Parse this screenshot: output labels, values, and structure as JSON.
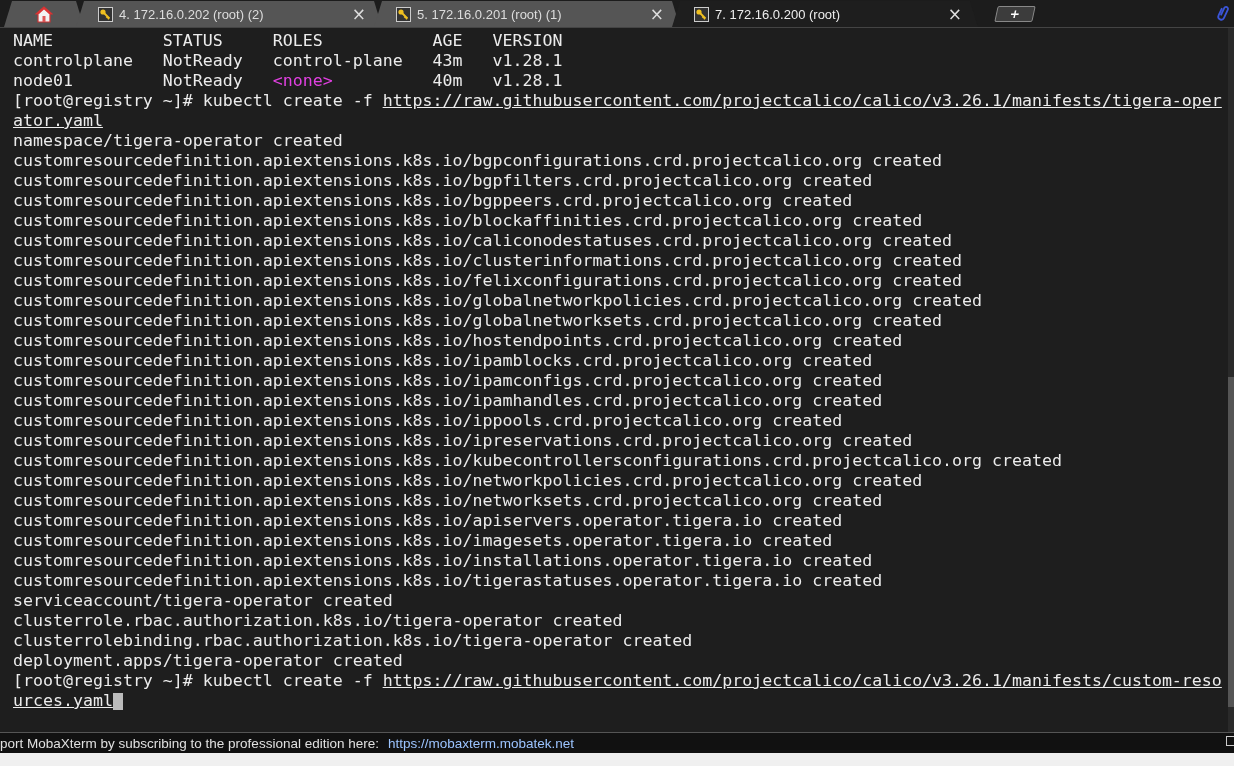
{
  "tabs": [
    {
      "kind": "home",
      "selected": false
    },
    {
      "kind": "session",
      "label": "4. 172.16.0.202 (root) (2)",
      "selected": false,
      "close": "×"
    },
    {
      "kind": "session",
      "label": "5. 172.16.0.201 (root) (1)",
      "selected": false,
      "close": "×"
    },
    {
      "kind": "session",
      "label": "7. 172.16.0.200 (root)",
      "selected": true,
      "close": "×"
    },
    {
      "kind": "new",
      "label": "+"
    }
  ],
  "terminal": {
    "lines": [
      [
        {
          "kind": "text",
          "text": "NAME           STATUS     ROLES           AGE   VERSION"
        }
      ],
      [
        {
          "kind": "text",
          "text": "controlplane   NotReady   control-plane   43m   v1.28.1"
        }
      ],
      [
        {
          "kind": "text",
          "text": "node01         NotReady   "
        },
        {
          "kind": "none",
          "text": "<none>"
        },
        {
          "kind": "text",
          "text": "          40m   v1.28.1"
        }
      ],
      [
        {
          "kind": "text",
          "text": "[root@registry ~]# kubectl create -f "
        },
        {
          "kind": "link",
          "text": "https://raw.githubusercontent.com/projectcalico/calico/v3.26.1/manifests/tigera-oper"
        }
      ],
      [
        {
          "kind": "link",
          "text": "ator.yaml"
        }
      ],
      [
        {
          "kind": "text",
          "text": "namespace/tigera-operator created"
        }
      ],
      [
        {
          "kind": "text",
          "text": "customresourcedefinition.apiextensions.k8s.io/bgpconfigurations.crd.projectcalico.org created"
        }
      ],
      [
        {
          "kind": "text",
          "text": "customresourcedefinition.apiextensions.k8s.io/bgpfilters.crd.projectcalico.org created"
        }
      ],
      [
        {
          "kind": "text",
          "text": "customresourcedefinition.apiextensions.k8s.io/bgppeers.crd.projectcalico.org created"
        }
      ],
      [
        {
          "kind": "text",
          "text": "customresourcedefinition.apiextensions.k8s.io/blockaffinities.crd.projectcalico.org created"
        }
      ],
      [
        {
          "kind": "text",
          "text": "customresourcedefinition.apiextensions.k8s.io/caliconodestatuses.crd.projectcalico.org created"
        }
      ],
      [
        {
          "kind": "text",
          "text": "customresourcedefinition.apiextensions.k8s.io/clusterinformations.crd.projectcalico.org created"
        }
      ],
      [
        {
          "kind": "text",
          "text": "customresourcedefinition.apiextensions.k8s.io/felixconfigurations.crd.projectcalico.org created"
        }
      ],
      [
        {
          "kind": "text",
          "text": "customresourcedefinition.apiextensions.k8s.io/globalnetworkpolicies.crd.projectcalico.org created"
        }
      ],
      [
        {
          "kind": "text",
          "text": "customresourcedefinition.apiextensions.k8s.io/globalnetworksets.crd.projectcalico.org created"
        }
      ],
      [
        {
          "kind": "text",
          "text": "customresourcedefinition.apiextensions.k8s.io/hostendpoints.crd.projectcalico.org created"
        }
      ],
      [
        {
          "kind": "text",
          "text": "customresourcedefinition.apiextensions.k8s.io/ipamblocks.crd.projectcalico.org created"
        }
      ],
      [
        {
          "kind": "text",
          "text": "customresourcedefinition.apiextensions.k8s.io/ipamconfigs.crd.projectcalico.org created"
        }
      ],
      [
        {
          "kind": "text",
          "text": "customresourcedefinition.apiextensions.k8s.io/ipamhandles.crd.projectcalico.org created"
        }
      ],
      [
        {
          "kind": "text",
          "text": "customresourcedefinition.apiextensions.k8s.io/ippools.crd.projectcalico.org created"
        }
      ],
      [
        {
          "kind": "text",
          "text": "customresourcedefinition.apiextensions.k8s.io/ipreservations.crd.projectcalico.org created"
        }
      ],
      [
        {
          "kind": "text",
          "text": "customresourcedefinition.apiextensions.k8s.io/kubecontrollersconfigurations.crd.projectcalico.org created"
        }
      ],
      [
        {
          "kind": "text",
          "text": "customresourcedefinition.apiextensions.k8s.io/networkpolicies.crd.projectcalico.org created"
        }
      ],
      [
        {
          "kind": "text",
          "text": "customresourcedefinition.apiextensions.k8s.io/networksets.crd.projectcalico.org created"
        }
      ],
      [
        {
          "kind": "text",
          "text": "customresourcedefinition.apiextensions.k8s.io/apiservers.operator.tigera.io created"
        }
      ],
      [
        {
          "kind": "text",
          "text": "customresourcedefinition.apiextensions.k8s.io/imagesets.operator.tigera.io created"
        }
      ],
      [
        {
          "kind": "text",
          "text": "customresourcedefinition.apiextensions.k8s.io/installations.operator.tigera.io created"
        }
      ],
      [
        {
          "kind": "text",
          "text": "customresourcedefinition.apiextensions.k8s.io/tigerastatuses.operator.tigera.io created"
        }
      ],
      [
        {
          "kind": "text",
          "text": "serviceaccount/tigera-operator created"
        }
      ],
      [
        {
          "kind": "text",
          "text": "clusterrole.rbac.authorization.k8s.io/tigera-operator created"
        }
      ],
      [
        {
          "kind": "text",
          "text": "clusterrolebinding.rbac.authorization.k8s.io/tigera-operator created"
        }
      ],
      [
        {
          "kind": "text",
          "text": "deployment.apps/tigera-operator created"
        }
      ],
      [
        {
          "kind": "text",
          "text": "[root@registry ~]# kubectl create -f "
        },
        {
          "kind": "link",
          "text": "https://raw.githubusercontent.com/projectcalico/calico/v3.26.1/manifests/custom-reso"
        }
      ],
      [
        {
          "kind": "link",
          "text": "urces.yaml"
        },
        {
          "kind": "cursor"
        }
      ]
    ]
  },
  "status_bar": {
    "message": "port MobaXterm by subscribing to the professional edition here:",
    "link": "https://mobaxterm.mobatek.net"
  }
}
